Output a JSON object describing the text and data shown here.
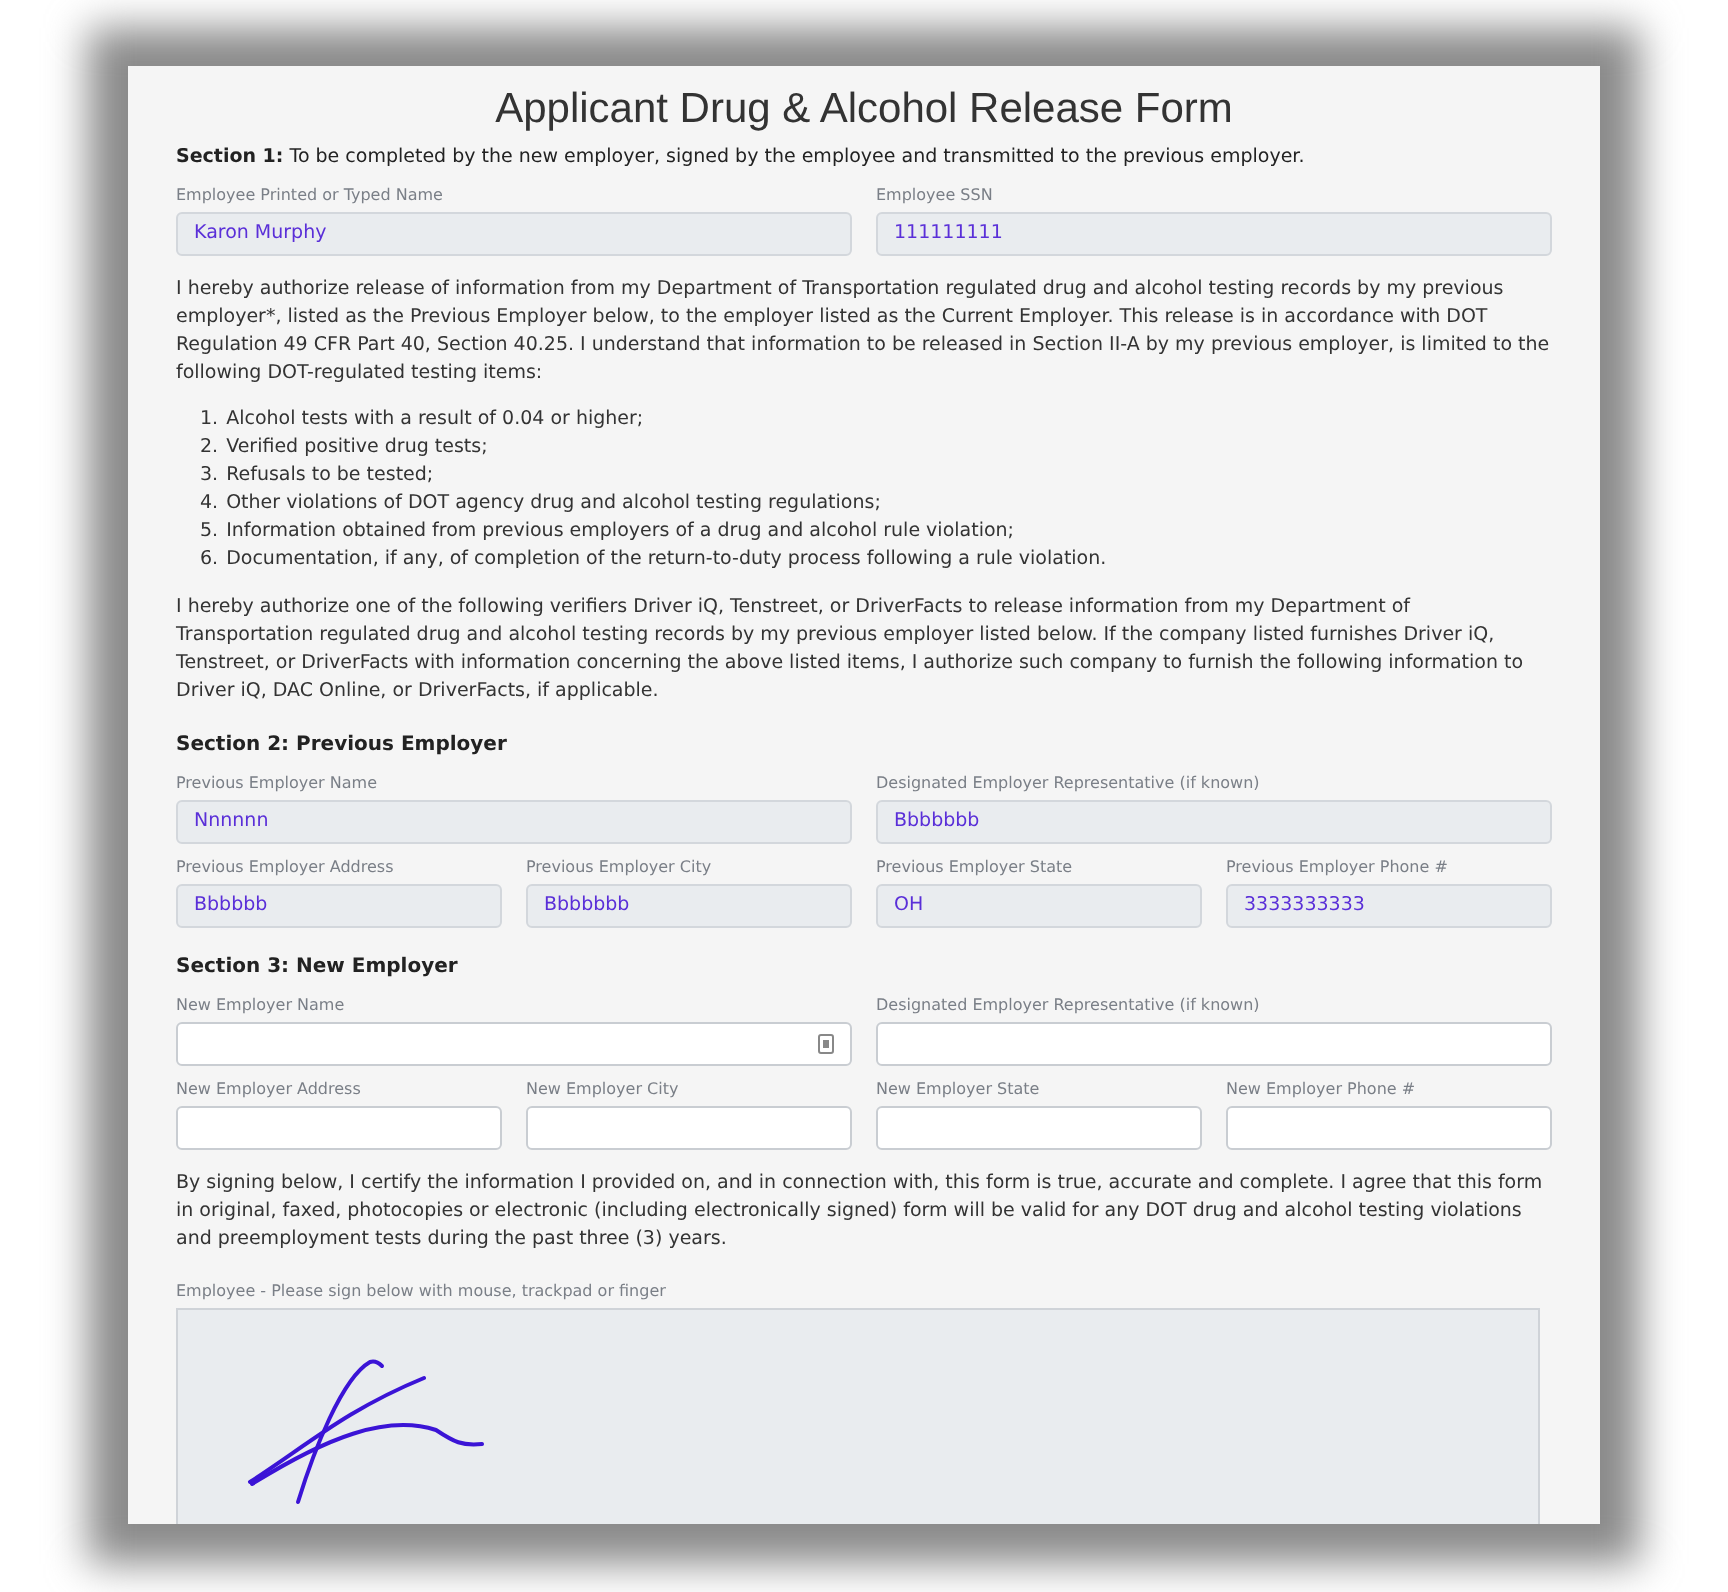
{
  "title": "Applicant Drug & Alcohol Release Form",
  "blocks": [
    {
      "kind": "note",
      "text": "**Section 1:** To be completed by the new employer, signed by the employee and transmitted to the previous employer."
    },
    {
      "kind": "fields",
      "fields": [
        {
          "label": "Employee Printed or Typed Name",
          "value": "Karon Murphy",
          "readonly": true
        },
        {
          "label": "Employee SSN",
          "value": "111111111",
          "readonly": true
        }
      ]
    },
    {
      "kind": "paragraph",
      "text": "I hereby authorize release of information from my Department of Transportation regulated drug and alcohol testing records by my previous employer*, listed as the Previous Employer below, to the employer listed as the Current Employer. This release is in accordance with DOT Regulation 49 CFR Part 40, Section 40.25. I understand that information to be released in Section II-A by my previous employer, is limited to the following DOT-regulated testing items:"
    },
    {
      "kind": "list",
      "items": [
        {
          "number": "1.",
          "text": "Alcohol tests with a result of 0.04 or higher;"
        },
        {
          "number": "2.",
          "text": "Verified positive drug tests;"
        },
        {
          "number": "3.",
          "text": "Refusals to be tested;"
        },
        {
          "number": "4.",
          "text": "Other violations of DOT agency drug and alcohol testing regulations;"
        },
        {
          "number": "5.",
          "text": "Information obtained from previous employers of a drug and alcohol rule violation;"
        },
        {
          "number": "6.",
          "text": "Documentation, if any, of completion of the return-to-duty process following a rule violation."
        }
      ]
    },
    {
      "kind": "paragraph",
      "text": "I hereby authorize one of the following verifiers Driver iQ, Tenstreet, or DriverFacts to release information from my Department of Transportation regulated drug and alcohol testing records by my previous employer listed below. If the company listed furnishes Driver iQ, Tenstreet, or DriverFacts with information concerning the above listed items, I authorize such company to furnish the following information to Driver iQ, DAC Online, or DriverFacts, if applicable."
    },
    {
      "kind": "heading",
      "text": "Section 2: Previous Employer"
    },
    {
      "kind": "fields",
      "fields": [
        {
          "label": "Previous Employer Name",
          "value": "Nnnnnn",
          "readonly": true
        },
        {
          "label": "Designated Employer Representative (if known)",
          "value": "Bbbbbbb",
          "readonly": true
        }
      ]
    },
    {
      "kind": "fields",
      "fields": [
        {
          "label": "Previous Employer Address",
          "value": "Bbbbbb",
          "readonly": true
        },
        {
          "label": "Previous Employer City",
          "value": "Bbbbbbb",
          "readonly": true
        },
        {
          "label": "Previous Employer State",
          "value": "OH",
          "readonly": true
        },
        {
          "label": "Previous Employer Phone #",
          "value": "3333333333",
          "readonly": true
        }
      ]
    },
    {
      "kind": "heading",
      "text": "Section 3: New Employer"
    },
    {
      "kind": "fields",
      "fields": [
        {
          "label": "New Employer Name",
          "readonly": false,
          "autofill_icon": true
        },
        {
          "label": "Designated Employer Representative (if known)",
          "readonly": false
        }
      ]
    },
    {
      "kind": "fields",
      "fields": [
        {
          "label": "New Employer Address",
          "readonly": false
        },
        {
          "label": "New Employer City",
          "readonly": false
        },
        {
          "label": "New Employer State",
          "readonly": false
        },
        {
          "label": "New Employer Phone #",
          "readonly": false
        }
      ]
    },
    {
      "kind": "paragraph",
      "text": "By signing below, I certify the information I provided on, and in connection with, this form is true, accurate and complete. I agree that this form in original, faxed, photocopies or electronic (including electronically signed) form will be valid for any DOT drug and alcohol testing violations and preemployment tests during the past three (3) years."
    },
    {
      "kind": "signature",
      "label": "Employee - Please sign below with mouse, trackpad or finger",
      "signed": true
    }
  ]
}
